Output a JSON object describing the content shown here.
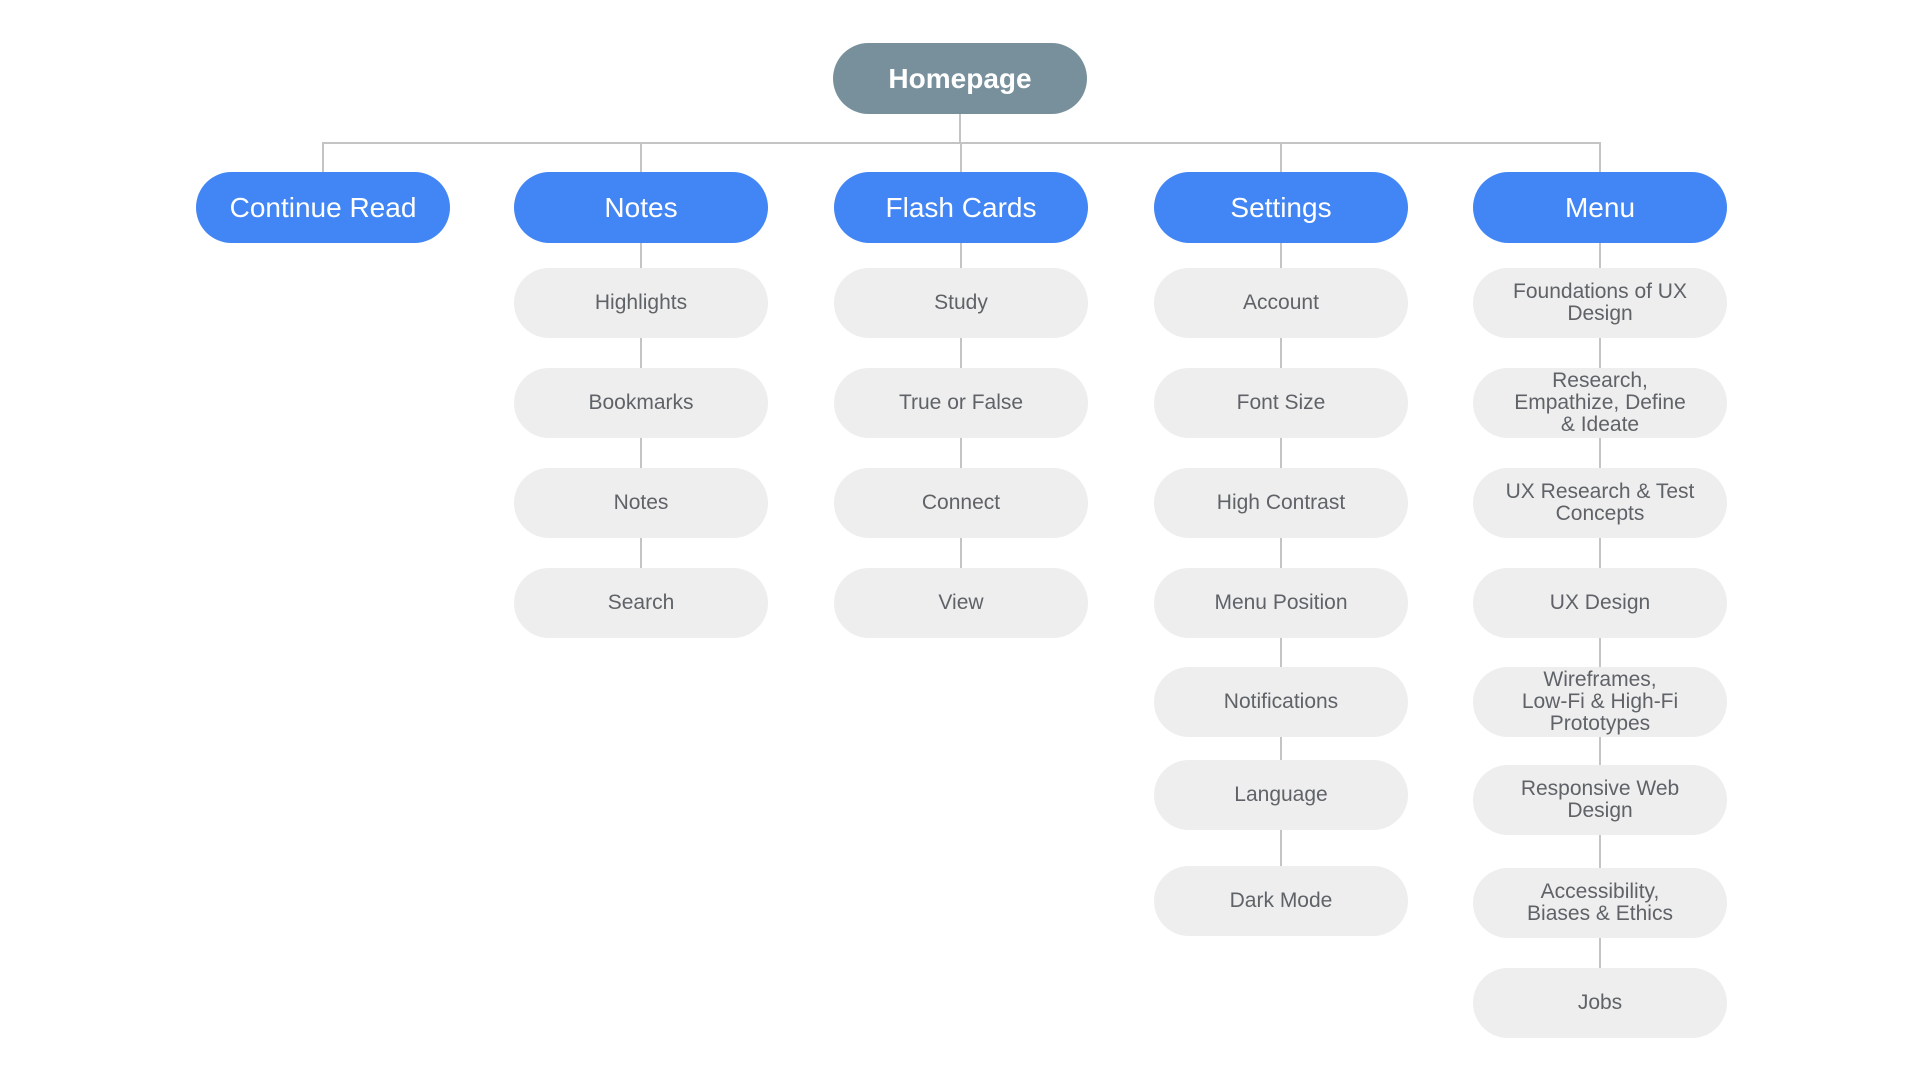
{
  "diagram": {
    "type": "sitemap",
    "colors": {
      "root": "#78909C",
      "section": "#4285F4",
      "child": "#EEEEEE",
      "child_text": "#5F6368",
      "connector": "#C4C4C4"
    },
    "root": {
      "label": "Homepage"
    },
    "sections": [
      {
        "label": "Continue Read",
        "children": []
      },
      {
        "label": "Notes",
        "children": [
          "Highlights",
          "Bookmarks",
          "Notes",
          "Search"
        ]
      },
      {
        "label": "Flash Cards",
        "children": [
          "Study",
          "True or False",
          "Connect",
          "View"
        ]
      },
      {
        "label": "Settings",
        "children": [
          "Account",
          "Font Size",
          "High Contrast",
          "Menu Position",
          "Notifications",
          "Language",
          "Dark Mode"
        ]
      },
      {
        "label": "Menu",
        "children": [
          "Foundations of UX\nDesign",
          "Research,\nEmpathize, Define\n& Ideate",
          "UX Research & Test\nConcepts",
          "UX Design",
          "Wireframes,\nLow-Fi & High-Fi\nPrototypes",
          "Responsive Web\nDesign",
          "Accessibility,\nBiases & Ethics",
          "Jobs"
        ]
      }
    ]
  }
}
